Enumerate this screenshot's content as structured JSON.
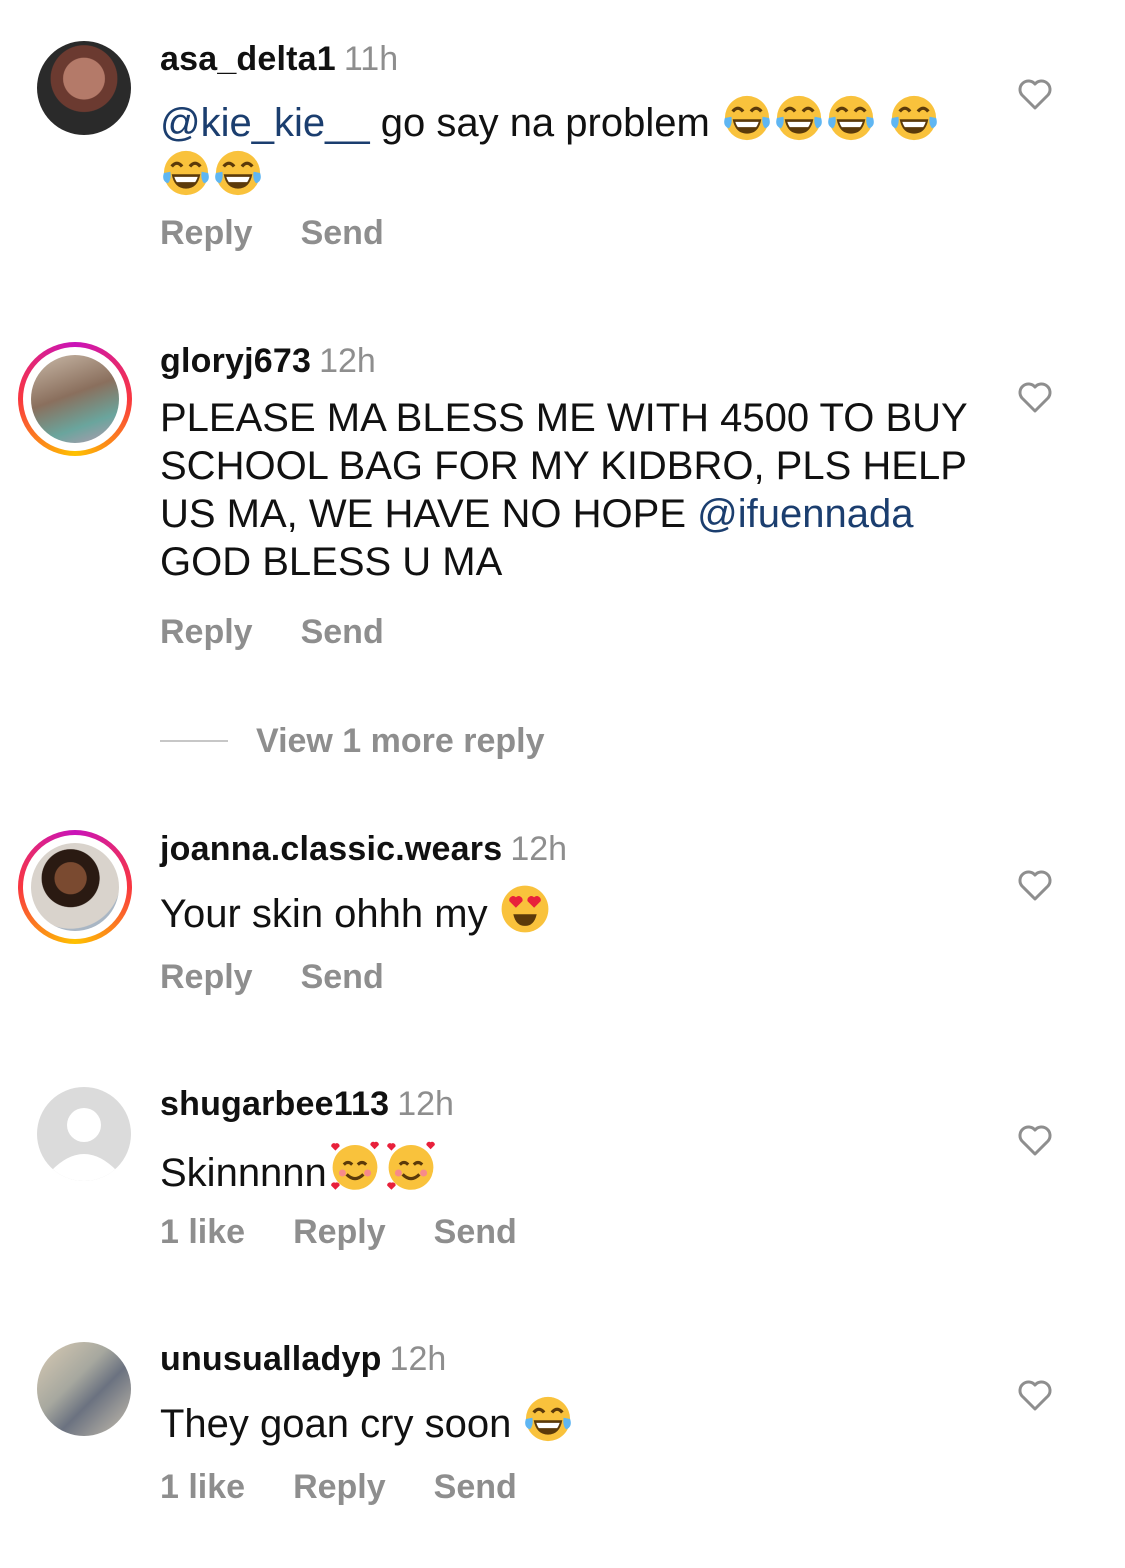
{
  "comments": [
    {
      "username": "asa_delta1",
      "time": "11h",
      "mention": "@kie_kie__",
      "text": " go say na problem",
      "emojis": [
        "joy",
        "joy",
        "joy",
        "joy",
        "joy",
        "joy"
      ],
      "likes": "",
      "reply": "Reply",
      "send": "Send"
    },
    {
      "username": "gloryj673",
      "time": "12h",
      "text_before": "PLEASE MA BLESS ME WITH 4500 TO BUY SCHOOL BAG FOR MY KIDBRO, PLS HELP US MA, WE HAVE NO HOPE ",
      "mention": "@ifuennada",
      "text_after": " GOD BLESS U MA",
      "reply": "Reply",
      "send": "Send"
    },
    {
      "username": "joanna.classic.wears",
      "time": "12h",
      "text": "Your skin ohhh my ",
      "emojis": [
        "heart-eyes"
      ],
      "reply": "Reply",
      "send": "Send"
    },
    {
      "username": "shugarbee113",
      "time": "12h",
      "text": "Skinnnnn",
      "emojis": [
        "smiling-hearts",
        "smiling-hearts"
      ],
      "likes": "1 like",
      "reply": "Reply",
      "send": "Send"
    },
    {
      "username": "unusualladyp",
      "time": "12h",
      "text": "They goan cry soon ",
      "emojis": [
        "joy"
      ],
      "likes": "1 like",
      "reply": "Reply",
      "send": "Send"
    }
  ],
  "view_more": "View 1 more reply",
  "colors": {
    "mention": "#1b3e6f",
    "muted": "#8e8e8e",
    "text": "#111111"
  }
}
